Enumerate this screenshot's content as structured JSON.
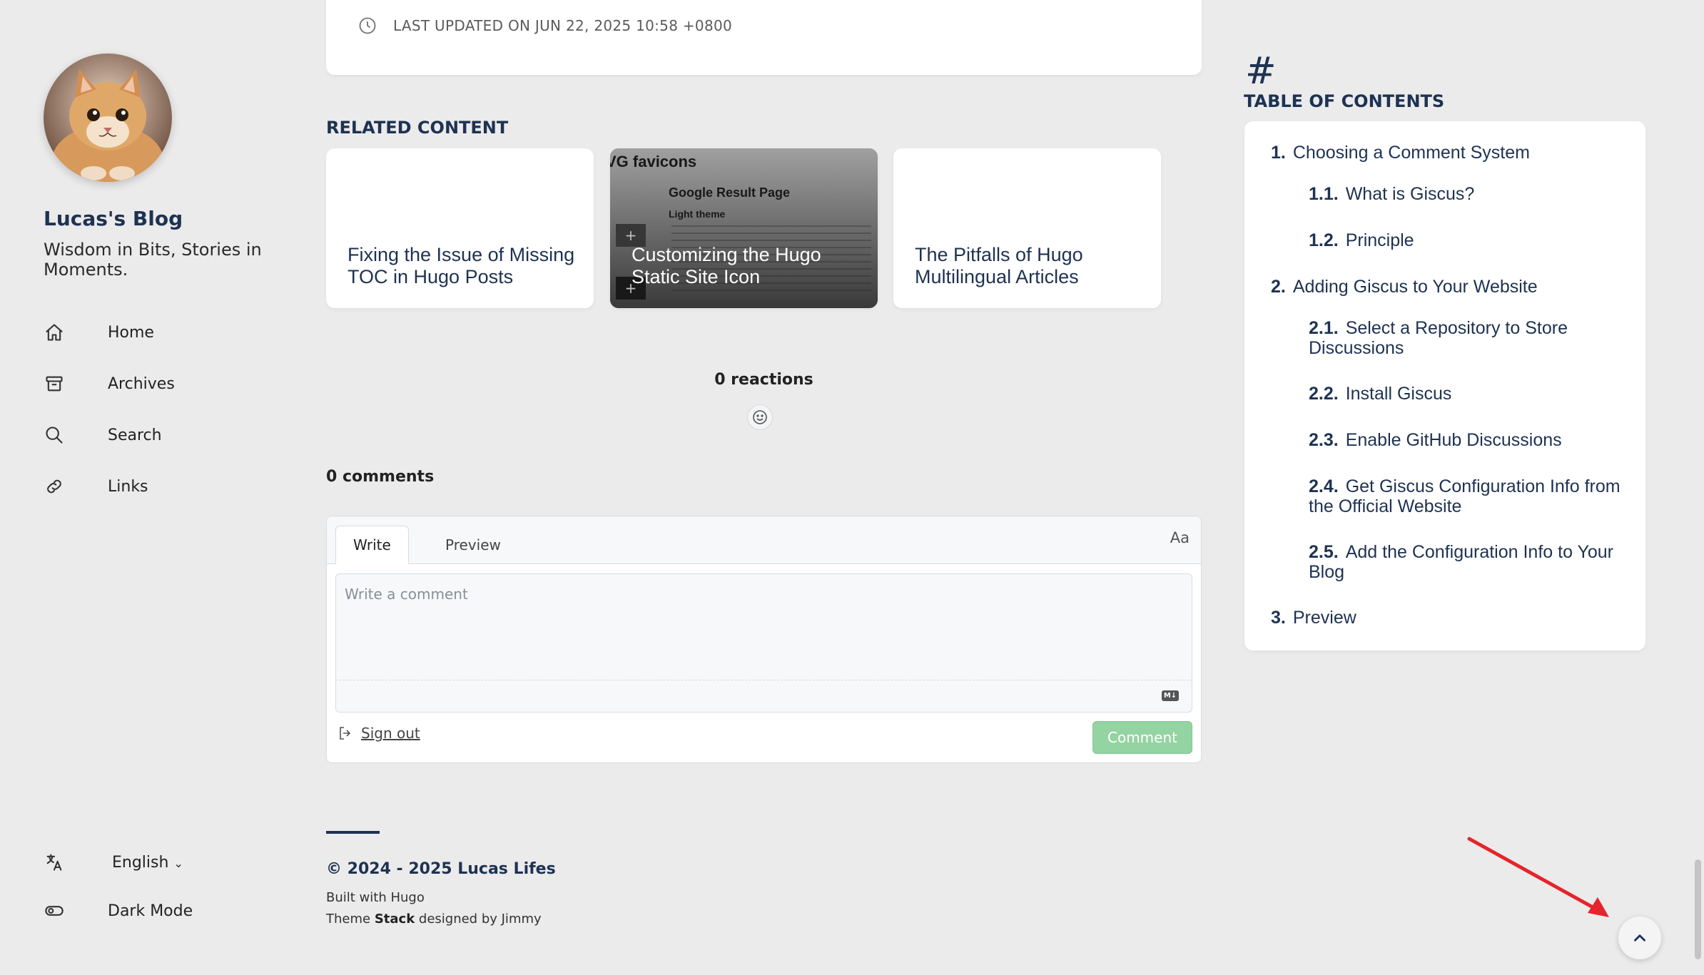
{
  "sidebar": {
    "site_name": "Lucas's Blog",
    "site_description": "Wisdom in Bits, Stories in Moments.",
    "menu": [
      {
        "label": "Home",
        "icon": "home-icon"
      },
      {
        "label": "Archives",
        "icon": "archive-icon"
      },
      {
        "label": "Search",
        "icon": "search-icon"
      },
      {
        "label": "Links",
        "icon": "link-icon"
      }
    ],
    "language": {
      "label": "English",
      "icon": "translate-icon"
    },
    "dark_mode": {
      "label": "Dark Mode",
      "icon": "toggle-icon"
    }
  },
  "article": {
    "last_updated": "LAST UPDATED ON JUN 22, 2025 10:58 +0800"
  },
  "related": {
    "title": "RELATED CONTENT",
    "items": [
      {
        "title": "Fixing the Issue of Missing TOC in Hugo Posts",
        "has_image": false
      },
      {
        "title": "Customizing the Hugo Static Site Icon",
        "has_image": true,
        "thumb_text": [
          "VG favicons",
          "Google Result Page",
          "Light theme"
        ]
      },
      {
        "title": "The Pitfalls of Hugo Multilingual Articles",
        "has_image": false
      }
    ]
  },
  "giscus": {
    "reactions": "0 reactions",
    "comments": "0 comments",
    "tabs": [
      "Write",
      "Preview"
    ],
    "aa_label": "Aa",
    "placeholder": "Write a comment",
    "value": "",
    "md_badge": "M↓",
    "sign_out": "Sign out",
    "comment_button": "Comment",
    "comment_button_color": "#94d3a2"
  },
  "footer": {
    "copyright": "© 2024 - 2025 Lucas Lifes",
    "built_with": "Built with Hugo",
    "theme_prefix": "Theme ",
    "theme_name": "Stack",
    "theme_suffix": " designed by Jimmy"
  },
  "toc": {
    "hash": "#",
    "title": "TABLE OF CONTENTS",
    "items": [
      {
        "num": "1.",
        "label": "Choosing a Comment System",
        "level": 1
      },
      {
        "num": "1.1.",
        "label": "What is Giscus?",
        "level": 2
      },
      {
        "num": "1.2.",
        "label": "Principle",
        "level": 2
      },
      {
        "num": "2.",
        "label": "Adding Giscus to Your Website",
        "level": 1
      },
      {
        "num": "2.1.",
        "label": "Select a Repository to Store Discussions",
        "level": 2
      },
      {
        "num": "2.2.",
        "label": "Install Giscus",
        "level": 2
      },
      {
        "num": "2.3.",
        "label": "Enable GitHub Discussions",
        "level": 2
      },
      {
        "num": "2.4.",
        "label": "Get Giscus Configuration Info from the Official Website",
        "level": 2
      },
      {
        "num": "2.5.",
        "label": "Add the Configuration Info to Your Blog",
        "level": 2
      },
      {
        "num": "3.",
        "label": "Preview",
        "level": 1
      }
    ]
  },
  "colors": {
    "accent": "#1e3252",
    "background": "#ebebeb",
    "annotation_arrow": "#e5242b"
  }
}
